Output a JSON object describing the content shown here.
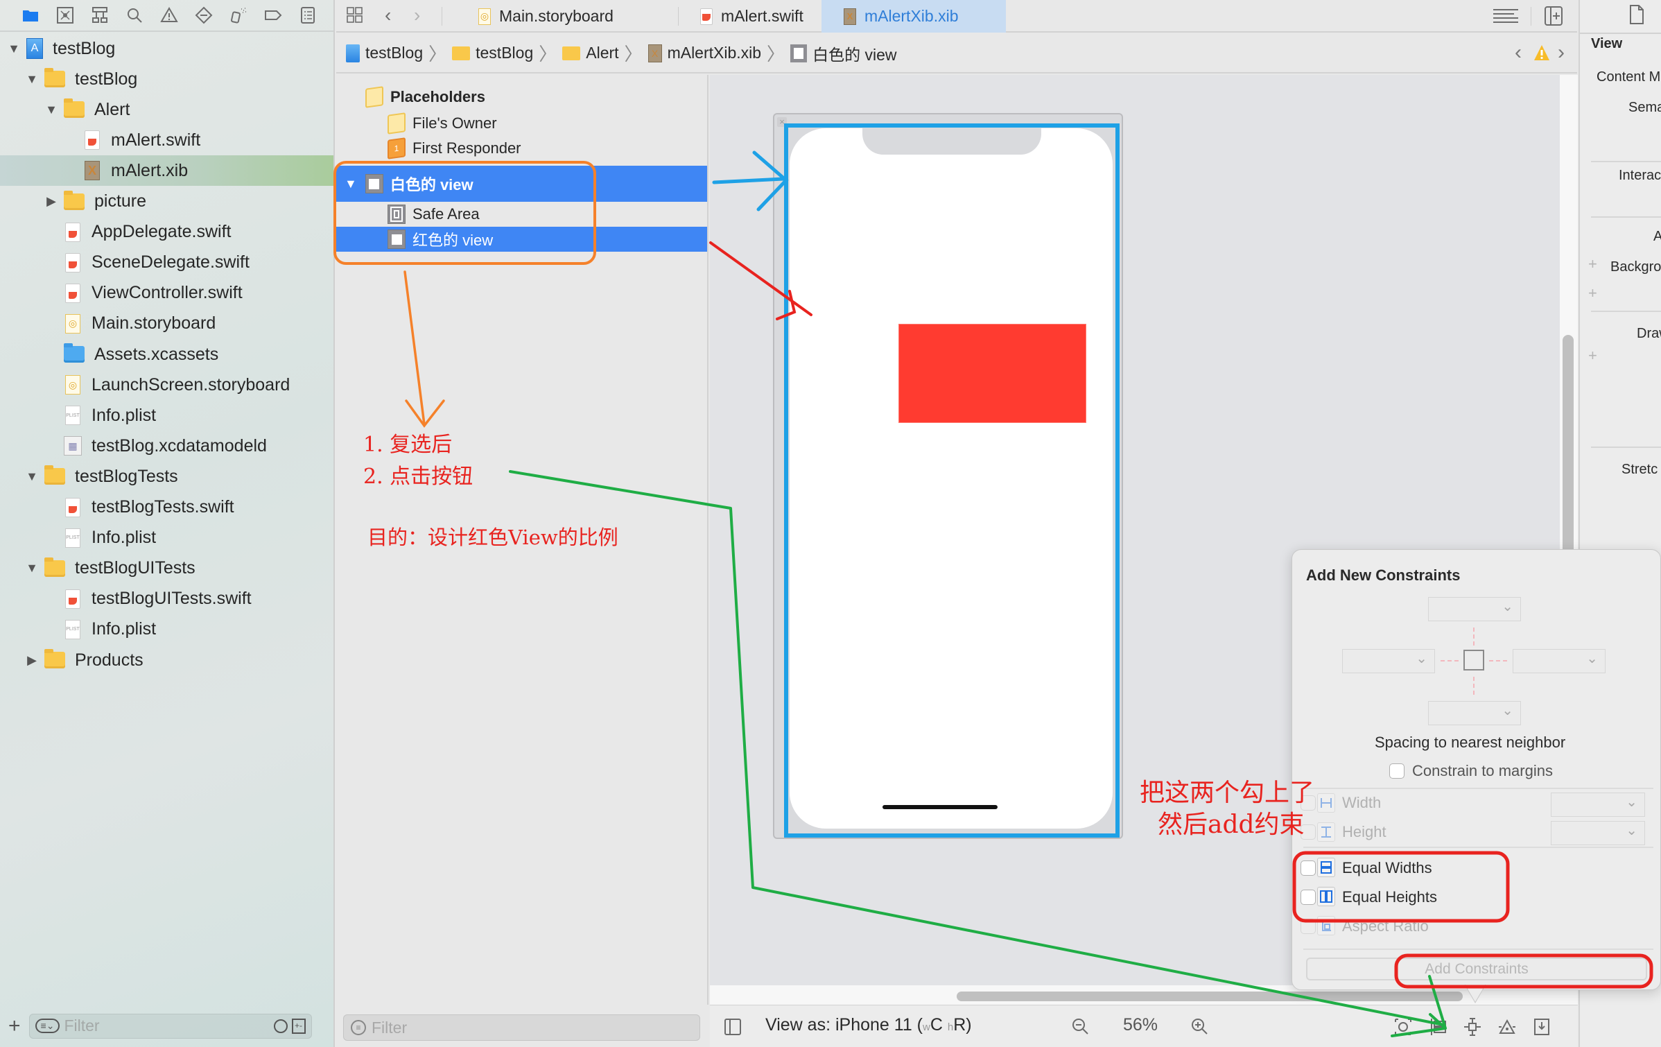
{
  "navigator": {
    "toolbar_icons": [
      "folder-icon",
      "source-control-icon",
      "hierarchy-icon",
      "search-icon",
      "warning-icon",
      "test-diamond-icon",
      "debug-spray-icon",
      "breakpoint-tag-icon",
      "report-list-icon"
    ],
    "tree": [
      {
        "label": "testBlog",
        "type": "project",
        "level": 0,
        "disclosure": "open"
      },
      {
        "label": "testBlog",
        "type": "folder",
        "level": 1,
        "disclosure": "open"
      },
      {
        "label": "Alert",
        "type": "folder",
        "level": 2,
        "disclosure": "open"
      },
      {
        "label": "mAlert.swift",
        "type": "swift",
        "level": 3
      },
      {
        "label": "mAlert.xib",
        "type": "xib",
        "level": 3,
        "selected": true
      },
      {
        "label": "picture",
        "type": "folder",
        "level": 2,
        "disclosure": "closed"
      },
      {
        "label": "AppDelegate.swift",
        "type": "swift",
        "level": 2
      },
      {
        "label": "SceneDelegate.swift",
        "type": "swift",
        "level": 2
      },
      {
        "label": "ViewController.swift",
        "type": "swift",
        "level": 2
      },
      {
        "label": "Main.storyboard",
        "type": "storyboard",
        "level": 2
      },
      {
        "label": "Assets.xcassets",
        "type": "assets",
        "level": 2
      },
      {
        "label": "LaunchScreen.storyboard",
        "type": "storyboard",
        "level": 2
      },
      {
        "label": "Info.plist",
        "type": "plist",
        "level": 2
      },
      {
        "label": "testBlog.xcdatamodeld",
        "type": "datamodel",
        "level": 2
      },
      {
        "label": "testBlogTests",
        "type": "folder",
        "level": 1,
        "disclosure": "open"
      },
      {
        "label": "testBlogTests.swift",
        "type": "swift",
        "level": 2
      },
      {
        "label": "Info.plist",
        "type": "plist",
        "level": 2
      },
      {
        "label": "testBlogUITests",
        "type": "folder",
        "level": 1,
        "disclosure": "open"
      },
      {
        "label": "testBlogUITests.swift",
        "type": "swift",
        "level": 2
      },
      {
        "label": "Info.plist",
        "type": "plist",
        "level": 2
      },
      {
        "label": "Products",
        "type": "folder",
        "level": 1,
        "disclosure": "closed"
      }
    ],
    "filter_placeholder": "Filter"
  },
  "tabs": [
    {
      "label": "Main.storyboard",
      "icon": "storyboard",
      "active": false
    },
    {
      "label": "mAlert.swift",
      "icon": "swift",
      "active": false
    },
    {
      "label": "mAlertXib.xib",
      "icon": "xib",
      "active": true
    }
  ],
  "breadcrumb": [
    {
      "label": "testBlog",
      "icon": "project"
    },
    {
      "label": "testBlog",
      "icon": "folder"
    },
    {
      "label": "Alert",
      "icon": "folder"
    },
    {
      "label": "mAlertXib.xib",
      "icon": "xib"
    },
    {
      "label": "白色的 view",
      "icon": "view"
    }
  ],
  "outline": {
    "placeholders_label": "Placeholders",
    "files_owner": "File's Owner",
    "first_responder": "First Responder",
    "white_view": "白色的 view",
    "safe_area": "Safe Area",
    "red_view": "红色的 view",
    "filter_placeholder": "Filter"
  },
  "canvas": {
    "red_view_color": "#ff3b30",
    "selection_color": "#1ea1e6"
  },
  "editor_bottom": {
    "view_as": "View as: iPhone 11 (",
    "size_w": "w",
    "size_c": "C",
    "size_h": "h",
    "size_r": "R)",
    "zoom_level": "56%"
  },
  "inspector": {
    "section": "View",
    "labels": [
      "Content M",
      "Sema",
      "Interac",
      "A",
      "Backgro",
      "Draw",
      "Stretc"
    ]
  },
  "popover": {
    "title": "Add New Constraints",
    "spacing_label": "Spacing to nearest neighbor",
    "constrain_margins": "Constrain to margins",
    "width": "Width",
    "height": "Height",
    "equal_widths": "Equal Widths",
    "equal_heights": "Equal Heights",
    "aspect_ratio": "Aspect Ratio",
    "add_button": "Add Constraints"
  },
  "annotations": {
    "step1": "1. 复选后",
    "step2": "2. 点击按钮",
    "purpose": "目的：设计红色View的比例",
    "check_note_line1": "把这两个勾上了",
    "check_note_line2": "然后add约束",
    "colors": {
      "orange": "#f5812a",
      "blue": "#1ea1e6",
      "red": "#e8231f",
      "green": "#1fad45"
    }
  }
}
